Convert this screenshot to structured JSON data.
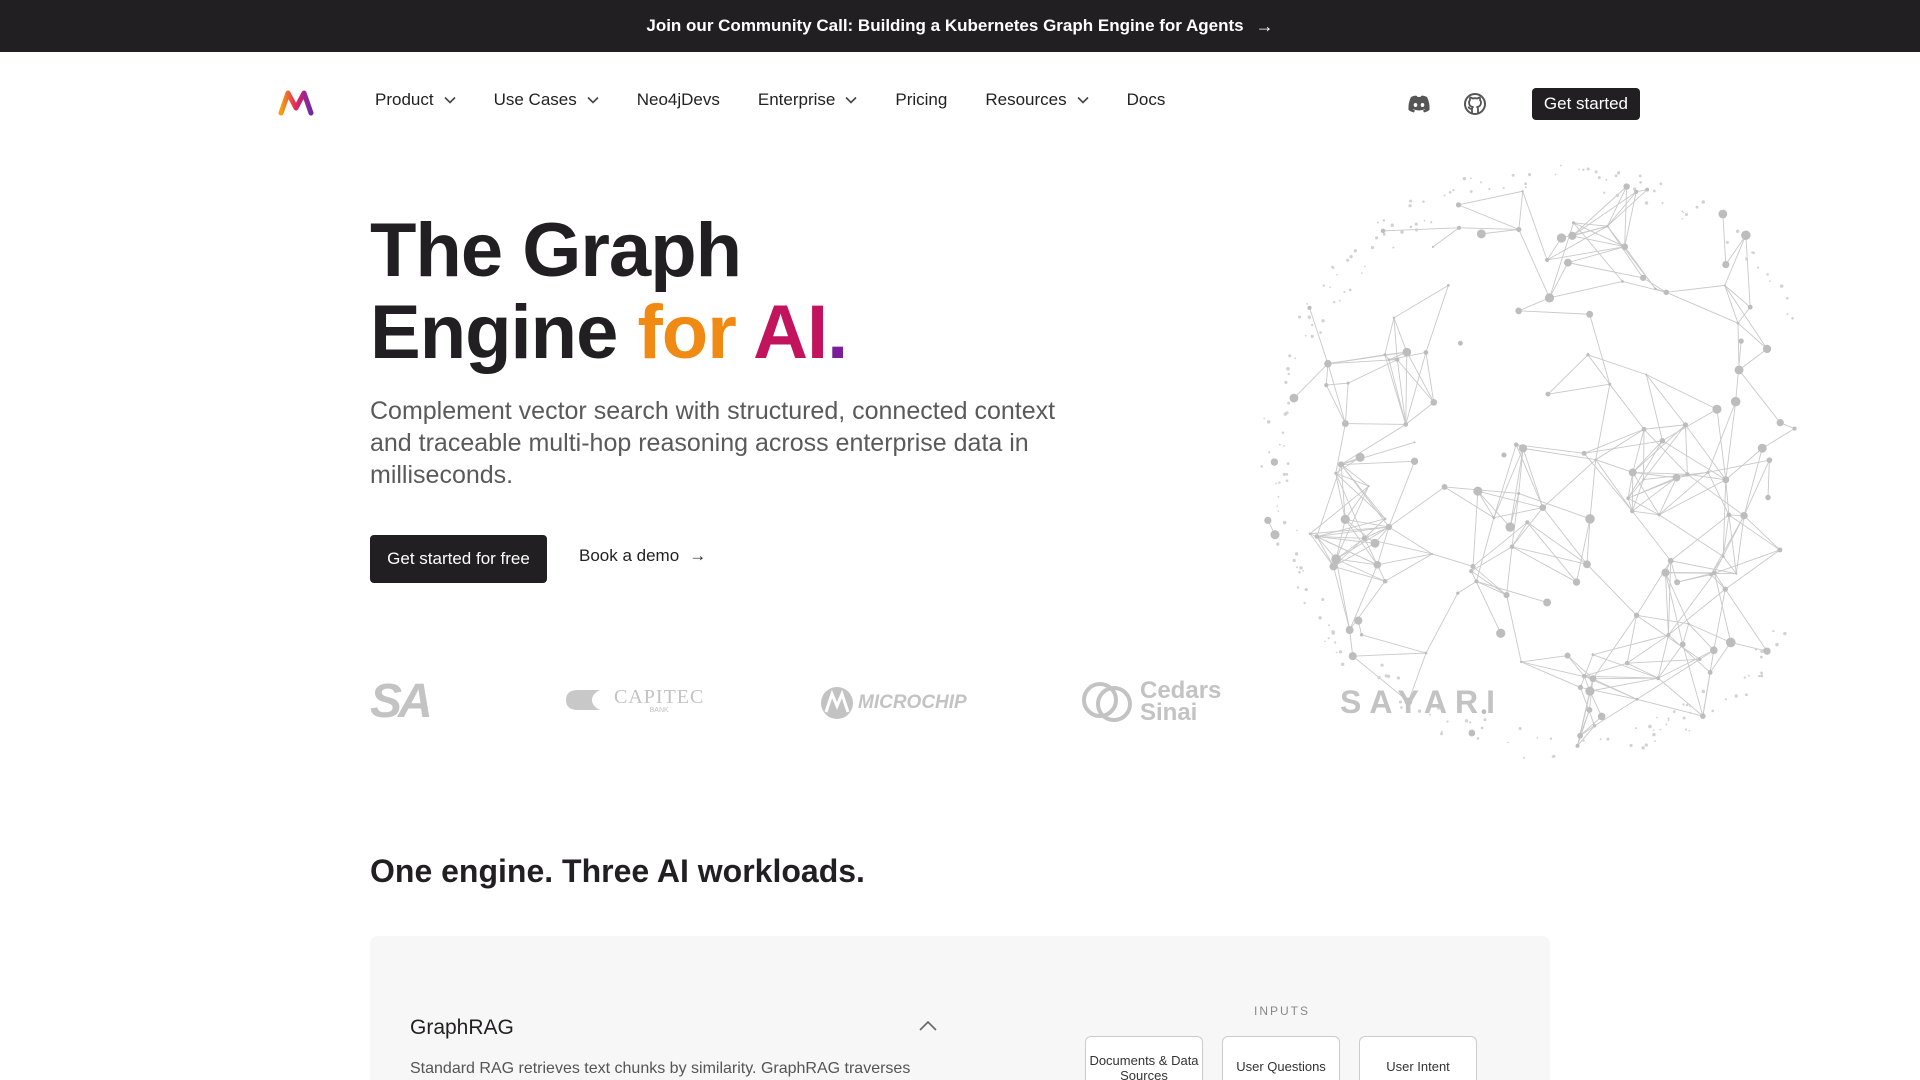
{
  "announcement": {
    "text": "Join our Community Call: Building a Kubernetes Graph Engine for Agents",
    "arrow": "→"
  },
  "nav": {
    "items": [
      {
        "label": "Product",
        "has_dropdown": true
      },
      {
        "label": "Use Cases",
        "has_dropdown": true
      },
      {
        "label": "Neo4jDevs",
        "has_dropdown": false
      },
      {
        "label": "Enterprise",
        "has_dropdown": true
      },
      {
        "label": "Pricing",
        "has_dropdown": false
      },
      {
        "label": "Resources",
        "has_dropdown": true
      },
      {
        "label": "Docs",
        "has_dropdown": false
      }
    ],
    "cta": "Get started",
    "icons": [
      "discord-icon",
      "github-icon"
    ]
  },
  "hero": {
    "title_line1": "The Graph",
    "title_line2_a": "Engine ",
    "title_line2_for": "for",
    "title_line2_ai": " AI",
    "title_line2_dot": ".",
    "subtitle": "Complement vector search with structured, connected context and traceable multi-hop reasoning across enterprise data in milliseconds.",
    "primary_cta": "Get started for free",
    "secondary_cta": "Book a demo",
    "secondary_arrow": "→"
  },
  "logos": {
    "items": [
      "SA",
      "CAPITEC",
      "BANK",
      "MICROCHIP",
      "Cedars",
      "Sinai",
      "SAYARI"
    ]
  },
  "workloads": {
    "title": "One engine. Three AI workloads.",
    "card": {
      "heading": "GraphRAG",
      "text": "Standard RAG retrieves text chunks by similarity. GraphRAG traverses",
      "inputs_label": "INPUTS",
      "inputs": [
        "Documents & Data Sources",
        "User Questions",
        "User Intent"
      ]
    }
  },
  "colors": {
    "dark": "#211f21",
    "accent_orange": "#f08a12",
    "accent_magenta": "#c2145c",
    "accent_purple": "#7a1f9a",
    "logo_gray": "#c3c3c3"
  }
}
